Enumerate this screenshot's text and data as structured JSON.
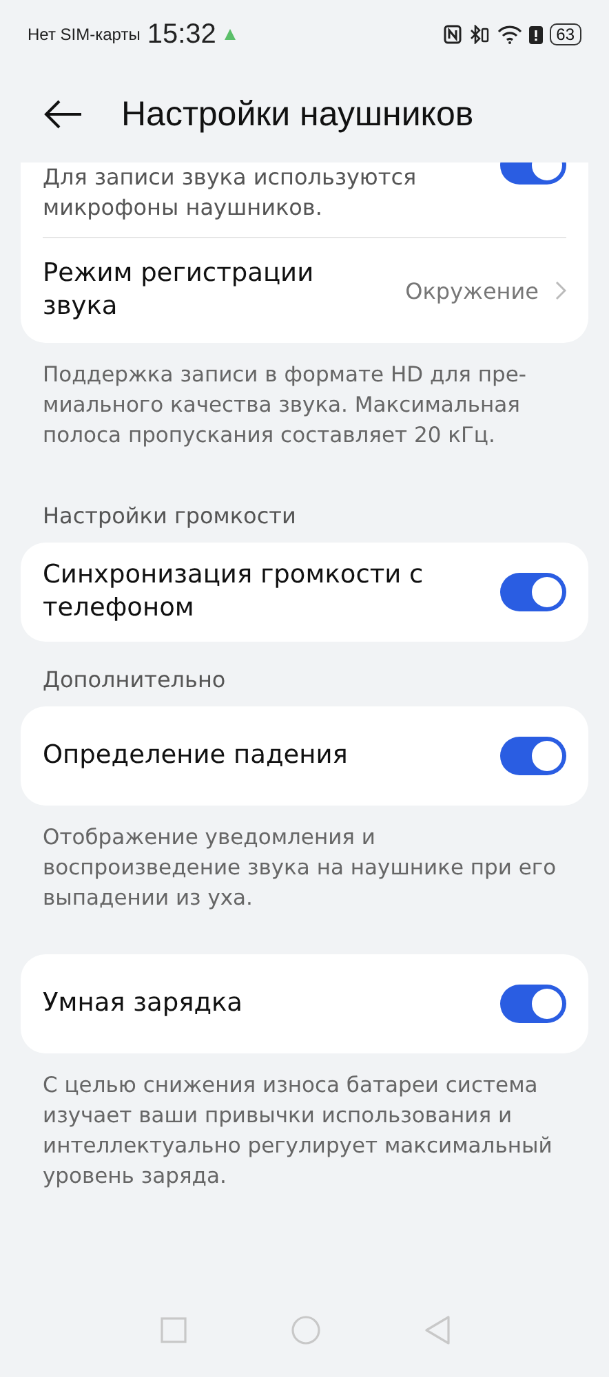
{
  "status_bar": {
    "carrier": "Нет SIM-карты",
    "time": "15:32",
    "battery": "63"
  },
  "header": {
    "title": "Настройки наушников"
  },
  "sections": [
    {
      "rows": [
        {
          "kind": "note_toggle",
          "label": "Для записи звука используются микрофоны наушников.",
          "on": true
        },
        {
          "kind": "link",
          "label": "Режим регистрации звука",
          "value": "Окружение"
        }
      ],
      "note": "Поддержка записи в формате HD для пре-миального качества звука. Максимальная полоса пропускания составляет 20 кГц."
    },
    {
      "heading": "Настройки громкости",
      "rows": [
        {
          "kind": "toggle",
          "label": "Синхронизация громкости с телефоном",
          "on": true
        }
      ]
    },
    {
      "heading": "Дополнительно",
      "rows": [
        {
          "kind": "toggle",
          "label": "Определение падения",
          "on": true
        }
      ],
      "note": "Отображение уведомления и воспроизведение звука на наушнике при его выпадении из уха."
    },
    {
      "rows": [
        {
          "kind": "toggle",
          "label": "Умная зарядка",
          "on": true
        }
      ],
      "note": "С целью снижения износа батареи система изучает ваши привычки использования и интеллектуально регулирует максимальный уровень заряда."
    }
  ]
}
